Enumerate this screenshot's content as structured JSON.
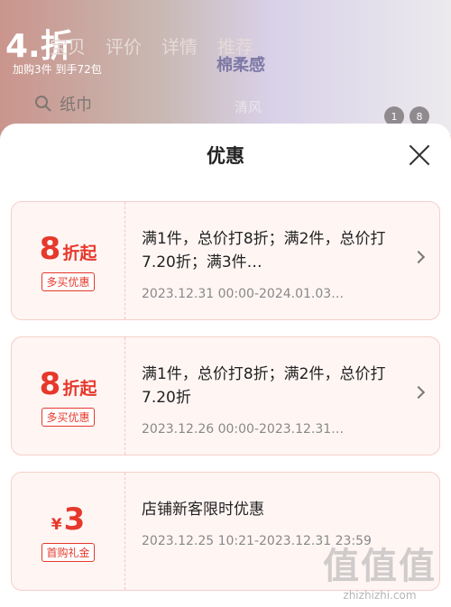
{
  "background": {
    "promo_big": "4.折",
    "promo_sub": "加购3件 到手72包",
    "nav": [
      "宝贝",
      "评价",
      "详情",
      "推荐"
    ],
    "search_text": "纸巾",
    "brand": "棉柔感",
    "products": "清风",
    "page_indicator": [
      "1",
      "8"
    ]
  },
  "sheet": {
    "title": "优惠"
  },
  "cards": [
    {
      "amount_big": "8",
      "amount_small": "折起",
      "tag": "多买优惠",
      "desc": "满1件，总价打8折；满2件，总价打7.20折；满3件…",
      "date": "2023.12.31 00:00-2024.01.03…"
    },
    {
      "amount_big": "8",
      "amount_small": "折起",
      "tag": "多买优惠",
      "desc": "满1件，总价打8折；满2件，总价打7.20折",
      "date": "2023.12.26 00:00-2023.12.31…"
    },
    {
      "currency": "¥",
      "amount_big": "3",
      "tag": "首购礼金",
      "desc": "店铺新客限时优惠",
      "date": "2023.12.25 10:21-2023.12.31 23:59"
    }
  ],
  "watermark": {
    "logo": "值值值",
    "site": "zhizhizhi.com"
  },
  "colors": {
    "accent": "#e6382b",
    "card_bg": "#fff6f4",
    "card_border": "#f5cfc8"
  }
}
